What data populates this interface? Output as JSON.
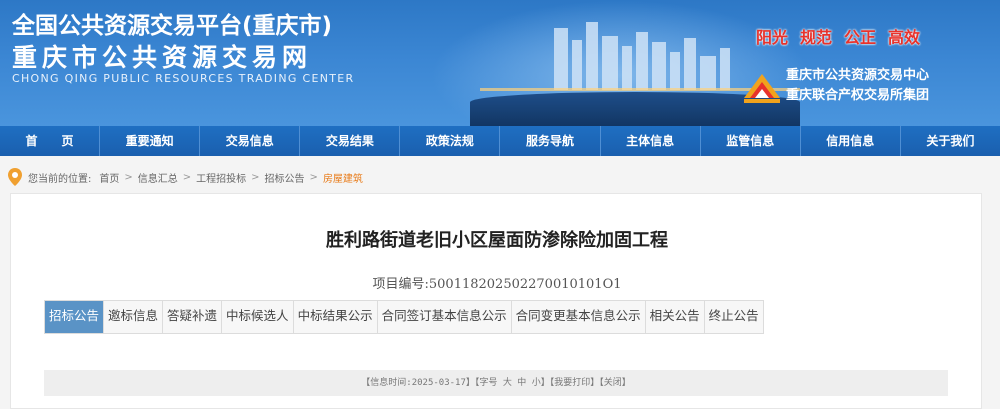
{
  "header": {
    "title_line1": "全国公共资源交易平台(重庆市)",
    "title_line2": "重庆市公共资源交易网",
    "title_en": "CHONG QING PUBLIC RESOURCES TRADING CENTER",
    "slogans": [
      "阳光",
      "规范",
      "公正",
      "高效"
    ],
    "org_name_1": "重庆市公共资源交易中心",
    "org_name_2": "重庆联合产权交易所集团",
    "slogan_color": "#e8322b",
    "banner_color": "#3b86d3"
  },
  "nav": {
    "items": [
      "首　　页",
      "重要通知",
      "交易信息",
      "交易结果",
      "政策法规",
      "服务导航",
      "主体信息",
      "监管信息",
      "信用信息",
      "关于我们"
    ]
  },
  "breadcrumb": {
    "prefix": "您当前的位置:",
    "items": [
      "首页",
      "信息汇总",
      "工程招投标",
      "招标公告",
      "房屋建筑"
    ],
    "separator": ">"
  },
  "article": {
    "title": "胜利路街道老旧小区屋面防渗除险加固工程",
    "project_no_label": "项目编号:",
    "project_no": "500118202502270010101O1"
  },
  "tabs": {
    "active_index": 0,
    "items": [
      "招标公告",
      "邀标信息",
      "答疑补遗",
      "中标候选人",
      "中标结果公示",
      "合同签订基本信息公示",
      "合同变更基本信息公示",
      "相关公告",
      "终止公告"
    ],
    "active_color": "#5a93c6"
  },
  "info_bar": {
    "time_label": "【信息时间:",
    "time_value": "2025-03-17",
    "font_prefix": "】【字号",
    "font_large": "大",
    "font_medium": "中",
    "font_small": "小",
    "print": "】【我要打印】",
    "close": "【关闭】"
  }
}
